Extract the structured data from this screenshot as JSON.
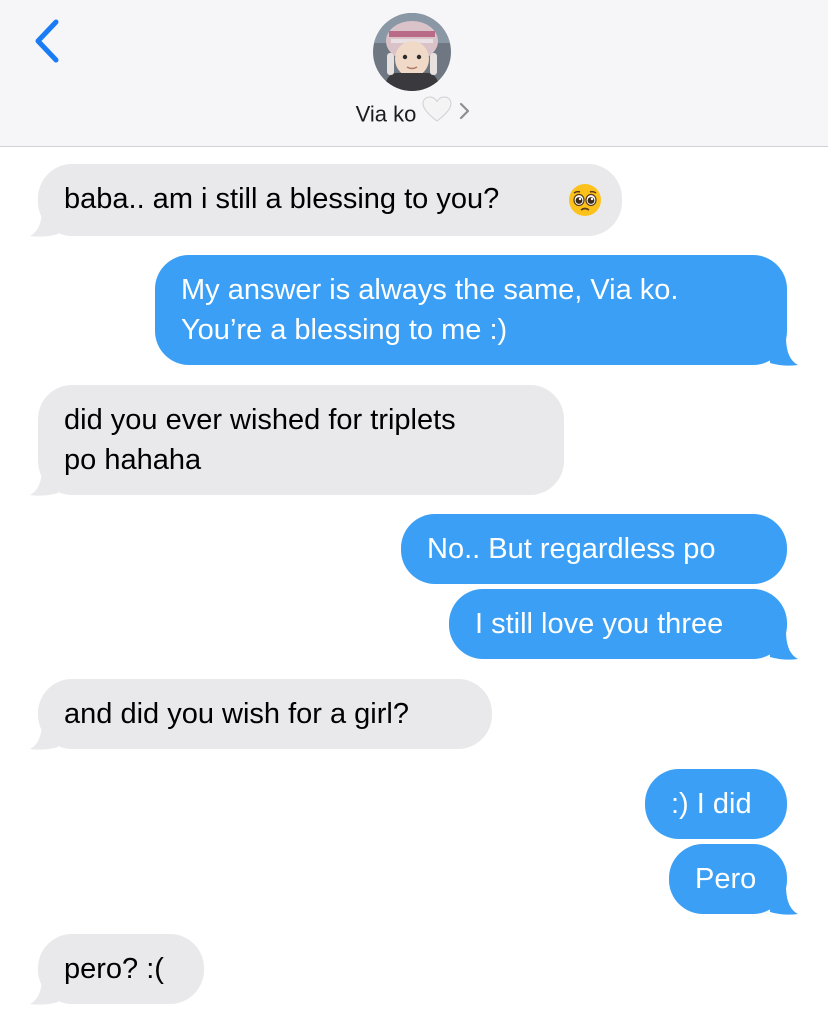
{
  "header": {
    "contact_name": "Via ko",
    "heart_icon": "white-heart-icon",
    "back_icon": "chevron-left-icon"
  },
  "colors": {
    "incoming": "#e9e9eb",
    "outgoing": "#3a9ff5",
    "accent": "#1a7cf5"
  },
  "messages": [
    {
      "sender": "them",
      "lines": [
        "baba.. am i still a blessing to you?"
      ],
      "emoji": "pleading-face"
    },
    {
      "sender": "me",
      "lines": [
        "My answer is always the same, Via ko.",
        "You’re a blessing to me :)"
      ]
    },
    {
      "sender": "them",
      "lines": [
        "did you ever wished for triplets",
        "po hahaha"
      ]
    },
    {
      "sender": "me",
      "lines": [
        "No.. But regardless po"
      ]
    },
    {
      "sender": "me",
      "lines": [
        "I still love you three"
      ]
    },
    {
      "sender": "them",
      "lines": [
        "and did you wish for a girl?"
      ]
    },
    {
      "sender": "me",
      "lines": [
        ":) I did"
      ]
    },
    {
      "sender": "me",
      "lines": [
        "Pero"
      ]
    },
    {
      "sender": "them",
      "lines": [
        "pero? :("
      ]
    }
  ]
}
